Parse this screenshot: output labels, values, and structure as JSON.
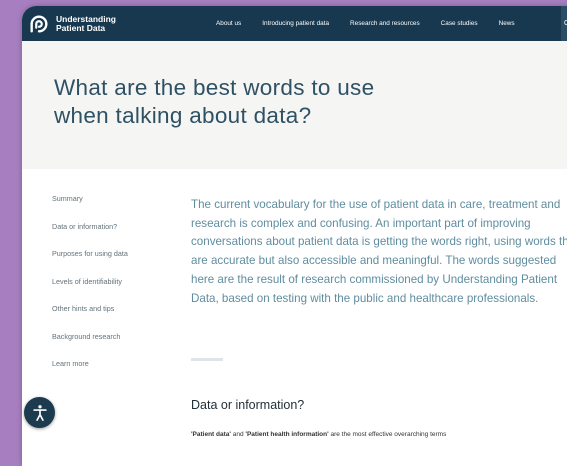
{
  "brand": {
    "line1": "Understanding",
    "line2": "Patient Data"
  },
  "nav": [
    "About us",
    "Introducing patient data",
    "Research and resources",
    "Case studies",
    "News"
  ],
  "nav_cutoff": "C",
  "hero": {
    "title": "What are the best words to use when talking about data?"
  },
  "sidebar": [
    "Summary",
    "Data or information?",
    "Purposes for using data",
    "Levels of identifiability",
    "Other hints and tips",
    "Background research",
    "Learn more"
  ],
  "intro": "The current vocabulary for the use of patient data in care, treatment and research is complex and confusing. An important part of improving conversations about patient data is getting the words right, using words that are accurate but also accessible and meaningful. The words suggested here are the result of research commissioned by Understanding Patient Data, based on testing with the public and healthcare professionals.",
  "section": {
    "title": "Data or information?",
    "term1": "'Patient data'",
    "joiner": " and ",
    "term2": "'Patient health information'",
    "rest": " are the most effective overarching terms"
  },
  "colors": {
    "accent": "#a77fc0",
    "navbar": "#17384f",
    "heading": "#2f5164",
    "body": "#5f8d9f"
  },
  "icons": {
    "logo": "brand-logo-icon",
    "accessibility": "accessibility-icon"
  }
}
